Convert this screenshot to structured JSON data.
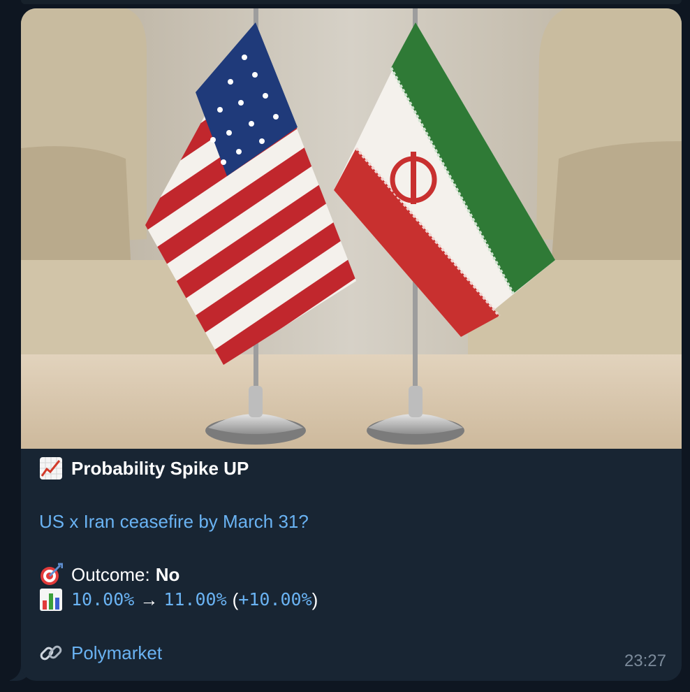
{
  "message": {
    "title": "Probability Spike UP",
    "question": "US x Iran ceasefire by March 31?",
    "outcome_label": "Outcome:",
    "outcome_value": "No",
    "prob_from": "10.00%",
    "arrow": "→",
    "prob_to": "11.00%",
    "change_open": "(",
    "change": "+10.00%",
    "change_close": ")",
    "link_text": "Polymarket",
    "time": "23:27"
  },
  "icons": {
    "title_icon": "chart-increasing-icon",
    "outcome_icon": "direct-hit-icon",
    "prob_icon": "bar-chart-icon",
    "link_icon": "link-icon"
  },
  "colors": {
    "bubble": "#182533",
    "background": "#0e1621",
    "link": "#6ab3f3",
    "time": "#7c8b9b"
  }
}
